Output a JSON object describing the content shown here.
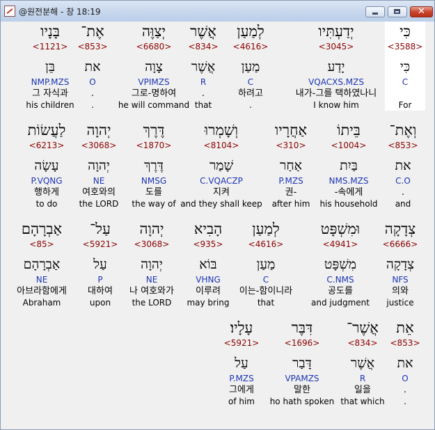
{
  "window": {
    "title": "@원전분해 - 창 18:19",
    "close_glyph": "✕"
  },
  "rows": [
    {
      "words": [
        {
          "heb": "כִּי",
          "num": "<3588>",
          "lemma": "כִּי",
          "parse": "C",
          "kor": "",
          "eng": "For",
          "highlight": true
        },
        {
          "heb": "יְדַעְתִּיו",
          "num": "<3045>",
          "lemma": "יָדַע",
          "parse": "VQACXS.MZS",
          "kor": "내가-그를 택하였나니",
          "eng": "I know him"
        },
        {
          "heb": "לְמַעַן",
          "num": "<4616>",
          "lemma": "מַעַן",
          "parse": "C",
          "kor": "하려고",
          "eng": "."
        },
        {
          "heb": "אֲשֶׁר",
          "num": "<834>",
          "lemma": "אֲשֶׁר",
          "parse": "R",
          "kor": ".",
          "eng": "that"
        },
        {
          "heb": "יְצַוֶּה",
          "num": "<6680>",
          "lemma": "צָוָה",
          "parse": "VPIMZS",
          "kor": "그로-명하여",
          "eng": "he will command"
        },
        {
          "heb": "אֶת־",
          "num": "<853>",
          "lemma": "את",
          "parse": "O",
          "kor": ".",
          "eng": "."
        },
        {
          "heb": "בָּנָיו",
          "num": "<1121>",
          "lemma": "בֵּן",
          "parse": "NMP.MZS",
          "kor": "그 자식과",
          "eng": "his children"
        }
      ]
    },
    {
      "words": [
        {
          "heb": "וְאֶת־",
          "num": "<853>",
          "lemma": "את",
          "parse": "C.O",
          "kor": ".",
          "eng": "and"
        },
        {
          "heb": "בֵּיתוֹ",
          "num": "<1004>",
          "lemma": "בַּיִת",
          "parse": "NMS.MZS",
          "kor": "-속에게",
          "eng": "his household"
        },
        {
          "heb": "אַחֲרָיו",
          "num": "<310>",
          "lemma": "אַחַר",
          "parse": "P.MZS",
          "kor": "권-",
          "eng": "after him"
        },
        {
          "heb": "וְשָׁמְרוּ",
          "num": "<8104>",
          "lemma": "שָׁמַר",
          "parse": "C.VQACZP",
          "kor": "지켜",
          "eng": "and they shall keep"
        },
        {
          "heb": "דֶּרֶךְ",
          "num": "<1870>",
          "lemma": "דֶּרֶךְ",
          "parse": "NMSG",
          "kor": "도를",
          "eng": "the way of"
        },
        {
          "heb": "יְהוָה",
          "num": "<3068>",
          "lemma": "יְהוָה",
          "parse": "NE",
          "kor": "여호와의",
          "eng": "the LORD"
        },
        {
          "heb": "לַעֲשׂוֹת",
          "num": "<6213>",
          "lemma": "עָשָׂה",
          "parse": "P.VQNG",
          "kor": "행하게",
          "eng": "to do"
        }
      ]
    },
    {
      "words": [
        {
          "heb": "צְדָקָה",
          "num": "<6666>",
          "lemma": "צְדָקָה",
          "parse": "NFS",
          "kor": "의와",
          "eng": "justice"
        },
        {
          "heb": "וּמִשְׁפָּט",
          "num": "<4941>",
          "lemma": "מִשְׁפָּט",
          "parse": "C.NMS",
          "kor": "공도를",
          "eng": "and judgment"
        },
        {
          "heb": "לְמַעַן",
          "num": "<4616>",
          "lemma": "מַעַן",
          "parse": "C",
          "kor": "이는-함이니라",
          "eng": "that"
        },
        {
          "heb": "הָבִיא",
          "num": "<935>",
          "lemma": "בּוֹא",
          "parse": "VHNG",
          "kor": "이루려",
          "eng": "may bring"
        },
        {
          "heb": "יְהוָה",
          "num": "<3068>",
          "lemma": "יְהוָה",
          "parse": "NE",
          "kor": "나 여호와가",
          "eng": "the LORD"
        },
        {
          "heb": "עַל־",
          "num": "<5921>",
          "lemma": "עַל",
          "parse": "P",
          "kor": "대하여",
          "eng": "upon"
        },
        {
          "heb": "אַבְרָהָם",
          "num": "<85>",
          "lemma": "אַבְרָהָם",
          "parse": "NE",
          "kor": "아브라함에게",
          "eng": "Abraham"
        }
      ]
    },
    {
      "words": [
        {
          "heb": "אֵת",
          "num": "<853>",
          "lemma": "את",
          "parse": "O",
          "kor": ".",
          "eng": "."
        },
        {
          "heb": "אֲשֶׁר־",
          "num": "<834>",
          "lemma": "אֲשֶׁר",
          "parse": "R",
          "kor": "일을",
          "eng": "that which"
        },
        {
          "heb": "דִּבֶּר",
          "num": "<1696>",
          "lemma": "דָּבַר",
          "parse": "VPAMZS",
          "kor": "말한",
          "eng": "ho hath spoken"
        },
        {
          "heb": "עָלָיו׃",
          "num": "<5921>",
          "lemma": "עַל",
          "parse": "P.MZS",
          "kor": "그에게",
          "eng": "of him"
        }
      ]
    }
  ]
}
